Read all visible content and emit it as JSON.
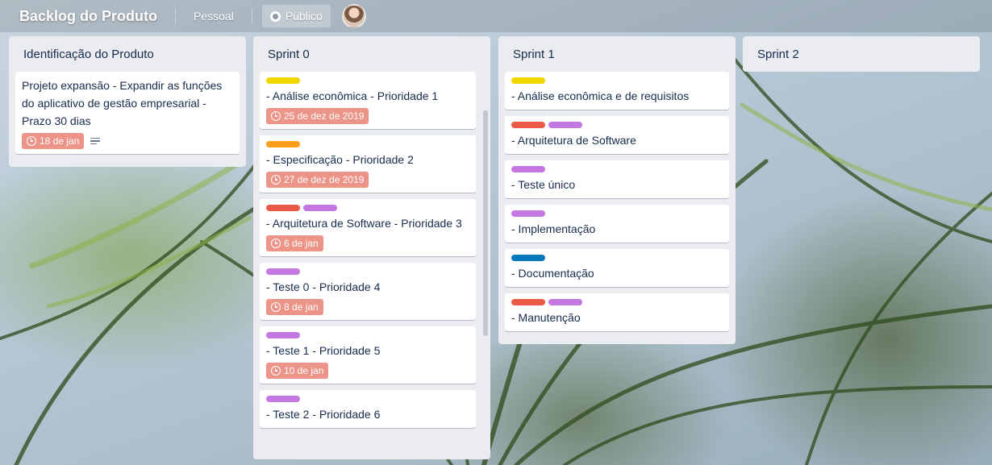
{
  "colors": {
    "yellow": "#f2d600",
    "orange": "#ff9f1a",
    "red": "#eb5a46",
    "purple": "#c377e0",
    "blue": "#0079bf",
    "due_badge": "#ec9488"
  },
  "header": {
    "board_title": "Backlog do Produto",
    "team_label": "Pessoal",
    "visibility_label": "Público"
  },
  "lists": [
    {
      "title": "Identificação do Produto",
      "cards": [
        {
          "title": "Projeto expansão - Expandir as funções do aplicativo de gestão empresarial - Prazo 30 dias",
          "labels": [],
          "due": "18 de jan",
          "has_description": true
        }
      ]
    },
    {
      "title": "Sprint 0",
      "cards": [
        {
          "title": "- Análise econômica - Prioridade 1",
          "labels": [
            "yellow"
          ],
          "due": "25 de dez de 2019"
        },
        {
          "title": "- Especificação - Prioridade 2",
          "labels": [
            "orange"
          ],
          "due": "27 de dez de 2019"
        },
        {
          "title": "- Arquitetura de Software - Prioridade 3",
          "labels": [
            "red",
            "purple"
          ],
          "due": "6 de jan"
        },
        {
          "title": "- Teste 0 - Prioridade 4",
          "labels": [
            "purple"
          ],
          "due": "8 de jan"
        },
        {
          "title": "- Teste 1 - Prioridade 5",
          "labels": [
            "purple"
          ],
          "due": "10 de jan"
        },
        {
          "title": "- Teste 2 - Prioridade 6",
          "labels": [
            "purple"
          ],
          "due": ""
        }
      ]
    },
    {
      "title": "Sprint 1",
      "cards": [
        {
          "title": "- Análise econômica e de requisitos",
          "labels": [
            "yellow"
          ]
        },
        {
          "title": "- Arquitetura de Software",
          "labels": [
            "red",
            "purple"
          ]
        },
        {
          "title": "- Teste único",
          "labels": [
            "purple"
          ]
        },
        {
          "title": "- Implementação",
          "labels": [
            "purple"
          ]
        },
        {
          "title": "- Documentação",
          "labels": [
            "blue"
          ]
        },
        {
          "title": "- Manutenção",
          "labels": [
            "red",
            "purple"
          ]
        }
      ]
    },
    {
      "title": "Sprint 2",
      "cards": []
    }
  ]
}
